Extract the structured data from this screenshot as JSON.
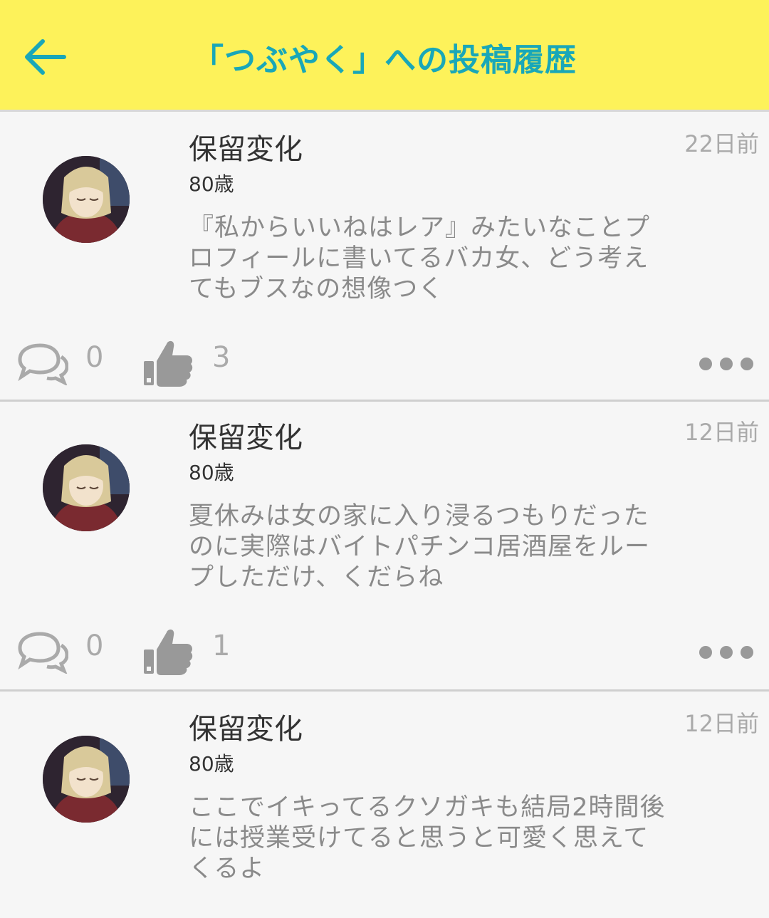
{
  "header": {
    "title": "「つぶやく」への投稿履歴",
    "back_icon": "arrow-left-icon",
    "bg_color": "#fdf25a",
    "title_color": "#19a7b8"
  },
  "posts": [
    {
      "name": "保留変化",
      "age": "80歳",
      "time": "22日前",
      "text": "『私からいいねはレア』みたいなことプロフィールに書いてるバカ女、どう考えてもブスなの想像つく",
      "comments": "0",
      "likes": "3"
    },
    {
      "name": "保留変化",
      "age": "80歳",
      "time": "12日前",
      "text": "夏休みは女の家に入り浸るつもりだったのに実際はバイトパチンコ居酒屋をループしただけ、くだらね",
      "comments": "0",
      "likes": "1"
    },
    {
      "name": "保留変化",
      "age": "80歳",
      "time": "12日前",
      "text": "ここでイキってるクソガキも結局2時間後には授業受けてると思うと可愛く思えてくるよ"
    }
  ]
}
